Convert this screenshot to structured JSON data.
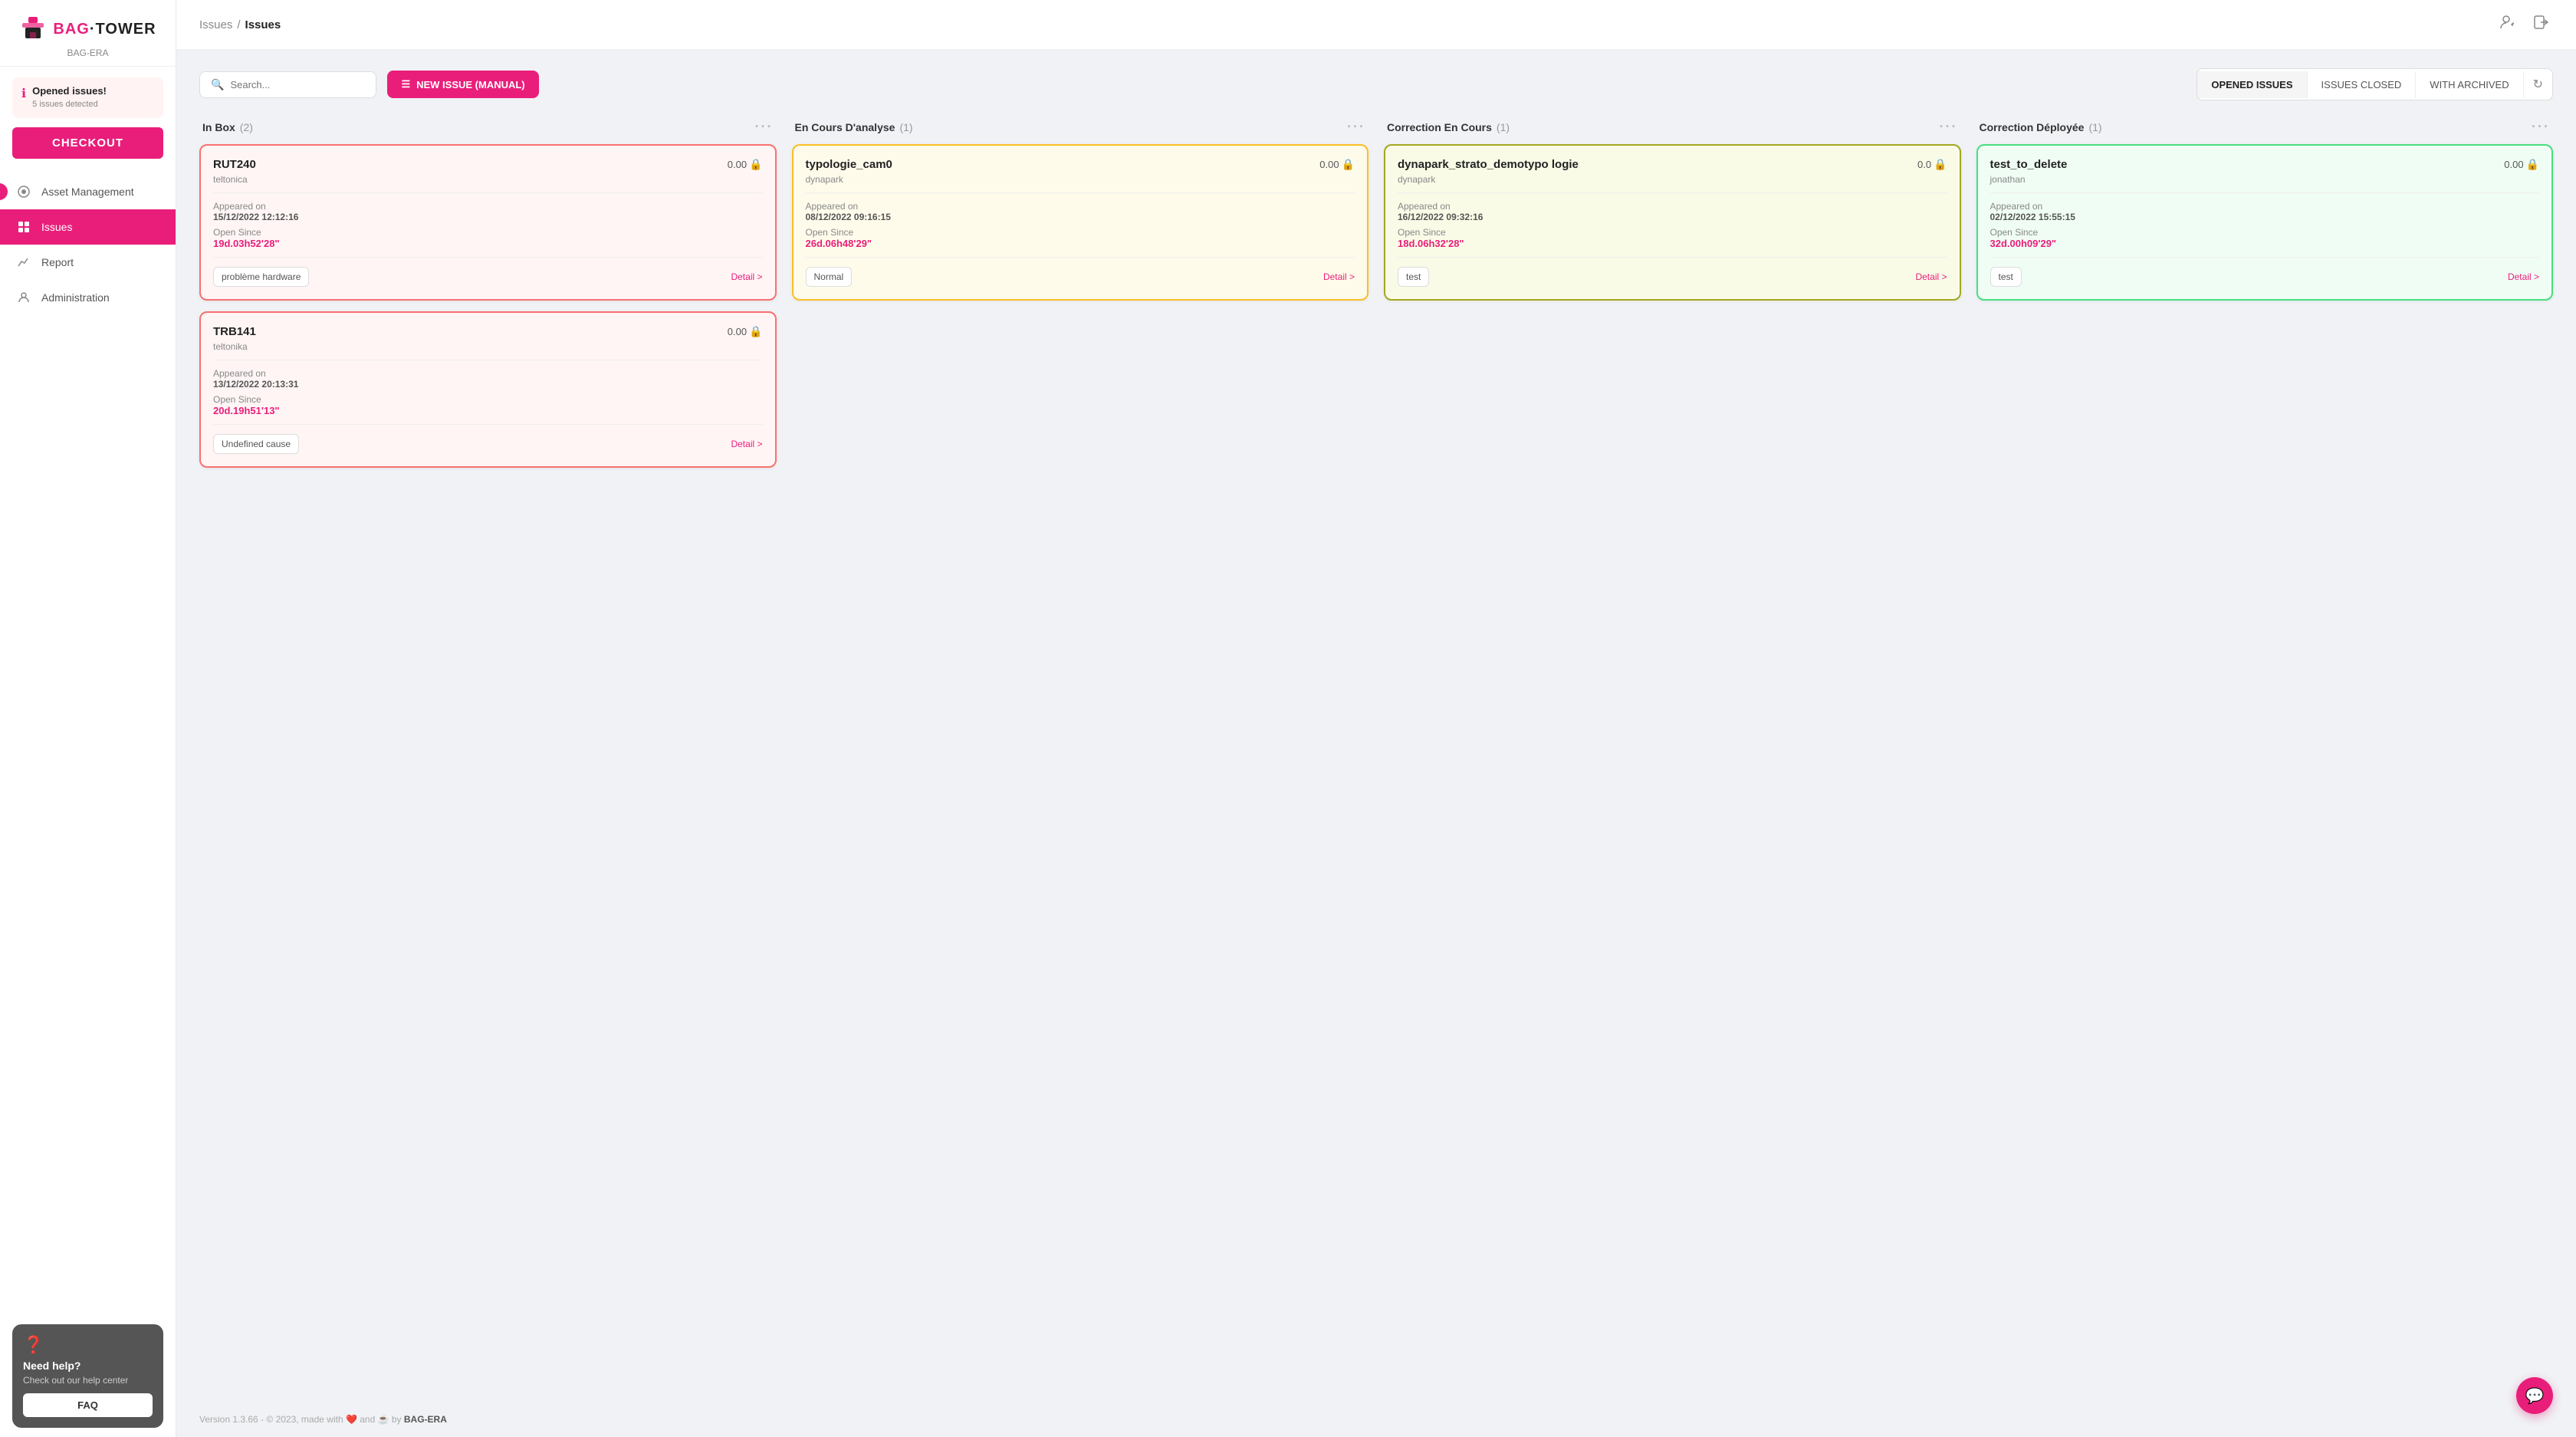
{
  "app": {
    "name": "BAG·TOWER",
    "sub": "BAG-ERA",
    "logo_icon": "🏷"
  },
  "alert": {
    "title": "Opened issues!",
    "subtitle": "5 issues detected"
  },
  "checkout_label": "CHECKOUT",
  "nav": {
    "items": [
      {
        "id": "asset-management",
        "label": "Asset Management",
        "icon": "⬡"
      },
      {
        "id": "issues",
        "label": "Issues",
        "icon": "⊞",
        "active": true
      },
      {
        "id": "report",
        "label": "Report",
        "icon": "📈"
      },
      {
        "id": "administration",
        "label": "Administration",
        "icon": "👤"
      }
    ]
  },
  "help": {
    "title": "Need help?",
    "subtitle": "Check out our help center",
    "faq_label": "FAQ"
  },
  "header": {
    "breadcrumb_parent": "Issues",
    "breadcrumb_sep": "/",
    "breadcrumb_current": "Issues"
  },
  "toolbar": {
    "search_placeholder": "Search...",
    "new_issue_label": "NEW ISSUE (MANUAL)",
    "tab_opened": "OPENED ISSUES",
    "tab_closed": "ISSUES CLOSED",
    "tab_archived": "WITH ARCHIVED"
  },
  "columns": [
    {
      "id": "inbox",
      "title": "In Box",
      "count": 2,
      "cards": [
        {
          "id": "RUT240",
          "version": "0.00",
          "org": "teltonica",
          "appeared_label": "Appeared on",
          "appeared_date": "15/12/2022 12:12:16",
          "open_since_label": "Open Since",
          "open_since_val": "19d.03h52'28\"",
          "tag": "problème hardware",
          "detail": "Detail >",
          "color": "red"
        },
        {
          "id": "TRB141",
          "version": "0.00",
          "org": "teltonika",
          "appeared_label": "Appeared on",
          "appeared_date": "13/12/2022 20:13:31",
          "open_since_label": "Open Since",
          "open_since_val": "20d.19h51'13\"",
          "tag": "Undefined cause",
          "detail": "Detail >",
          "color": "red"
        }
      ]
    },
    {
      "id": "en-cours",
      "title": "En Cours D'analyse",
      "count": 1,
      "cards": [
        {
          "id": "typologie_cam0",
          "version": "0.00",
          "org": "dynapark",
          "appeared_label": "Appeared on",
          "appeared_date": "08/12/2022 09:16:15",
          "open_since_label": "Open Since",
          "open_since_val": "26d.06h48'29\"",
          "tag": "Normal",
          "detail": "Detail >",
          "color": "yellow"
        }
      ]
    },
    {
      "id": "correction-en-cours",
      "title": "Correction En Cours",
      "count": 1,
      "cards": [
        {
          "id": "dynapark_strato_demotypo logie",
          "version": "0.0",
          "org": "dynapark",
          "appeared_label": "Appeared on",
          "appeared_date": "16/12/2022 09:32:16",
          "open_since_label": "Open Since",
          "open_since_val": "18d.06h32'28\"",
          "tag": "test",
          "detail": "Detail >",
          "color": "olive"
        }
      ]
    },
    {
      "id": "correction-deployee",
      "title": "Correction Déployée",
      "count": 1,
      "cards": [
        {
          "id": "test_to_delete",
          "version": "0.00",
          "org": "jonathan",
          "appeared_label": "Appeared on",
          "appeared_date": "02/12/2022 15:55:15",
          "open_since_label": "Open Since",
          "open_since_val": "32d.00h09'29\"",
          "tag": "test",
          "detail": "Detail >",
          "color": "green"
        }
      ]
    }
  ],
  "footer": {
    "text": "Version 1.3.66 - © 2023, made with ❤️ and ☕ by BAG-ERA"
  }
}
